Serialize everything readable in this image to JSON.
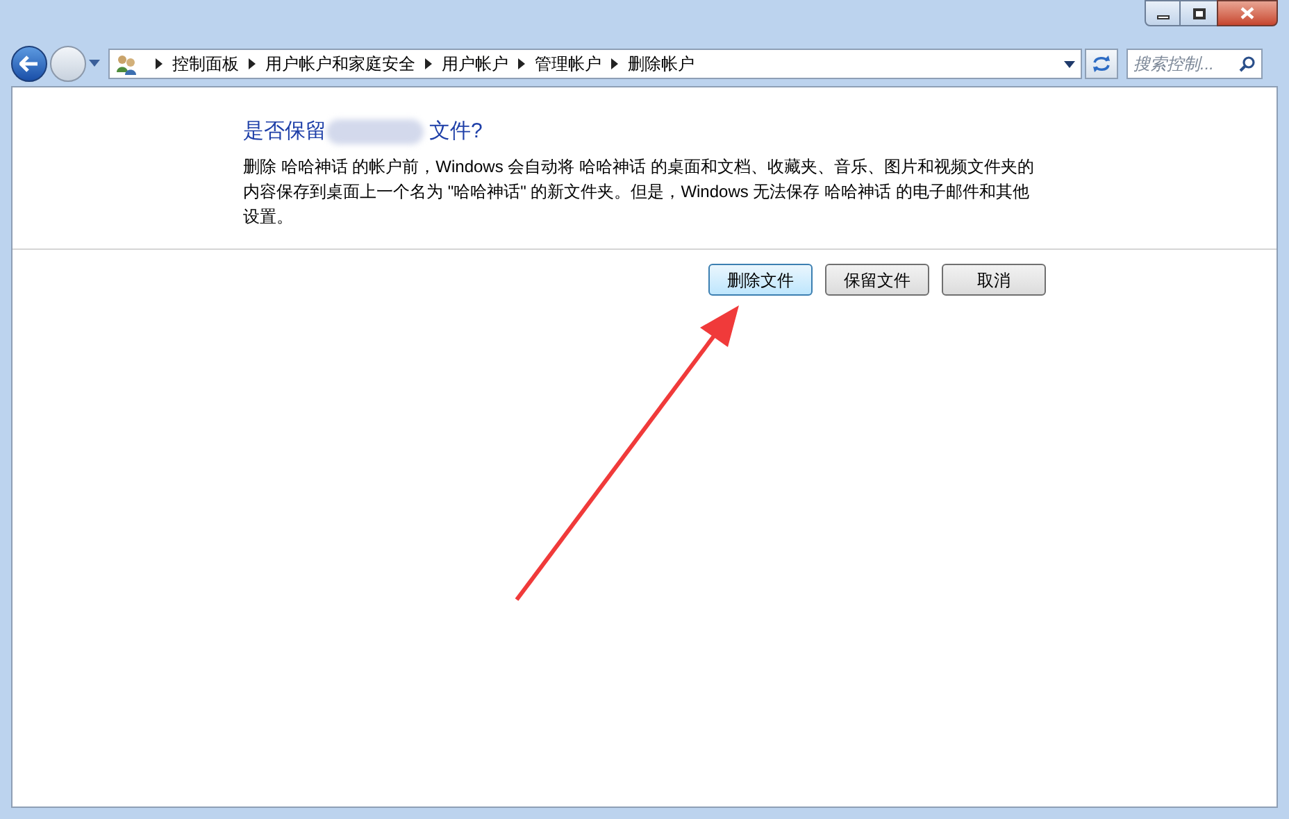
{
  "address_bar": {
    "breadcrumbs": [
      "控制面板",
      "用户帐户和家庭安全",
      "用户帐户",
      "管理帐户",
      "删除帐户"
    ]
  },
  "search": {
    "placeholder": "搜索控制..."
  },
  "dialog": {
    "title_start": "是否保留",
    "title_end": "文件?",
    "description": "删除 哈哈神话 的帐户前，Windows 会自动将 哈哈神话 的桌面和文档、收藏夹、音乐、图片和视频文件夹的内容保存到桌面上一个名为 \"哈哈神话\" 的新文件夹。但是，Windows 无法保存 哈哈神话 的电子邮件和其他设置。"
  },
  "buttons": [
    {
      "label": "删除文件",
      "selected": true
    },
    {
      "label": "保留文件",
      "selected": false
    },
    {
      "label": "取消",
      "selected": false
    }
  ]
}
